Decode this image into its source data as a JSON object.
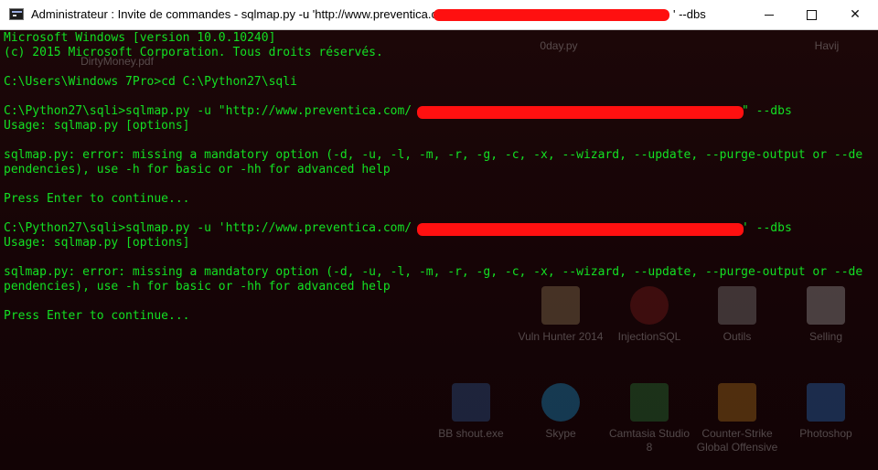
{
  "window": {
    "title": "Administrateur : Invite de commandes - sqlmap.py  -u 'http://www.preventica.com/",
    "title_suffix": "' --dbs",
    "icon": "cmd-icon",
    "controls": {
      "minimize": "—",
      "maximize": "☐",
      "close": "✕"
    }
  },
  "console": {
    "color": "#13e023",
    "lines": [
      "Microsoft Windows [version 10.0.10240]",
      "(c) 2015 Microsoft Corporation. Tous droits réservés.",
      "C:\\Users\\Windows 7Pro>cd C:\\Python27\\sqli",
      "C:\\Python27\\sqli>sqlmap.py -u \"http://www.preventica.com/",
      "\" --dbs",
      "Usage: sqlmap.py [options]",
      "sqlmap.py: error: missing a mandatory option (-d, -u, -l, -m, -r, -g, -c, -x, --wizard, --update, --purge-output or --de",
      "pendencies), use -h for basic or -hh for advanced help",
      "Press Enter to continue...",
      "C:\\Python27\\sqli>sqlmap.py -u 'http://www.preventica.com/",
      "' --dbs",
      "Usage: sqlmap.py [options]",
      "sqlmap.py: error: missing a mandatory option (-d, -u, -l, -m, -r, -g, -c, -x, --wizard, --update, --purge-output or --de",
      "pendencies), use -h for basic or -hh for advanced help",
      "Press Enter to continue..."
    ]
  },
  "desktop_icons": [
    {
      "label": "0day.py",
      "icon": "python-file-icon"
    },
    {
      "label": "Havij",
      "icon": "havij-icon"
    },
    {
      "label": "DirtyMoney.pdf",
      "icon": "pdf-icon"
    },
    {
      "label": "Vuln Hunter 2014",
      "icon": "vuln-hunter-icon"
    },
    {
      "label": "InjectionSQL",
      "icon": "injectionsql-icon"
    },
    {
      "label": "Outils",
      "icon": "tools-icon"
    },
    {
      "label": "Selling",
      "icon": "selling-icon"
    },
    {
      "label": "BB shout.exe",
      "icon": "exe-icon"
    },
    {
      "label": "Skype",
      "icon": "skype-icon"
    },
    {
      "label": "Camtasia Studio 8",
      "icon": "camtasia-icon"
    },
    {
      "label": "Counter-Strike Global Offensive",
      "icon": "csgo-icon"
    },
    {
      "label": "Photoshop",
      "icon": "photoshop-icon"
    }
  ]
}
